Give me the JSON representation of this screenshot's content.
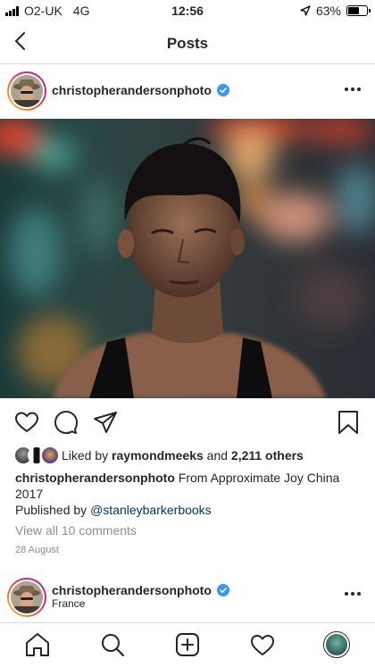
{
  "status_bar": {
    "carrier": "O2-UK",
    "network": "4G",
    "time": "12:56",
    "battery": "63%",
    "battery_level": 0.63
  },
  "nav": {
    "title": "Posts"
  },
  "post": {
    "username": "christopherandersonphoto",
    "verified": true,
    "likes": {
      "prefix": "Liked by",
      "liked_by_user": "raymondmeeks",
      "joiner": "and",
      "others": "2,211 others"
    },
    "caption": {
      "username": "christopherandersonphoto",
      "text": "From Approximate Joy China 2017"
    },
    "published": {
      "prefix": "Published by",
      "handle": "@stanleybarkerbooks"
    },
    "view_comments": "View all 10 comments",
    "date": "28 August"
  },
  "next_post": {
    "username": "christopherandersonphoto",
    "verified": true,
    "location": "France"
  },
  "icons": {
    "back": "chevron-left-icon",
    "more": "more-horizontal-icon",
    "like": "heart-icon",
    "comment": "comment-icon",
    "share": "paper-plane-icon",
    "save": "bookmark-icon",
    "home": "home-icon",
    "search": "search-icon",
    "new_post": "plus-square-icon",
    "activity": "heart-icon",
    "profile": "profile-avatar"
  },
  "colors": {
    "text": "#262626",
    "muted": "#8e8e8e",
    "link": "#003569",
    "verified": "#3897f0",
    "divider": "#dbdbdb"
  }
}
